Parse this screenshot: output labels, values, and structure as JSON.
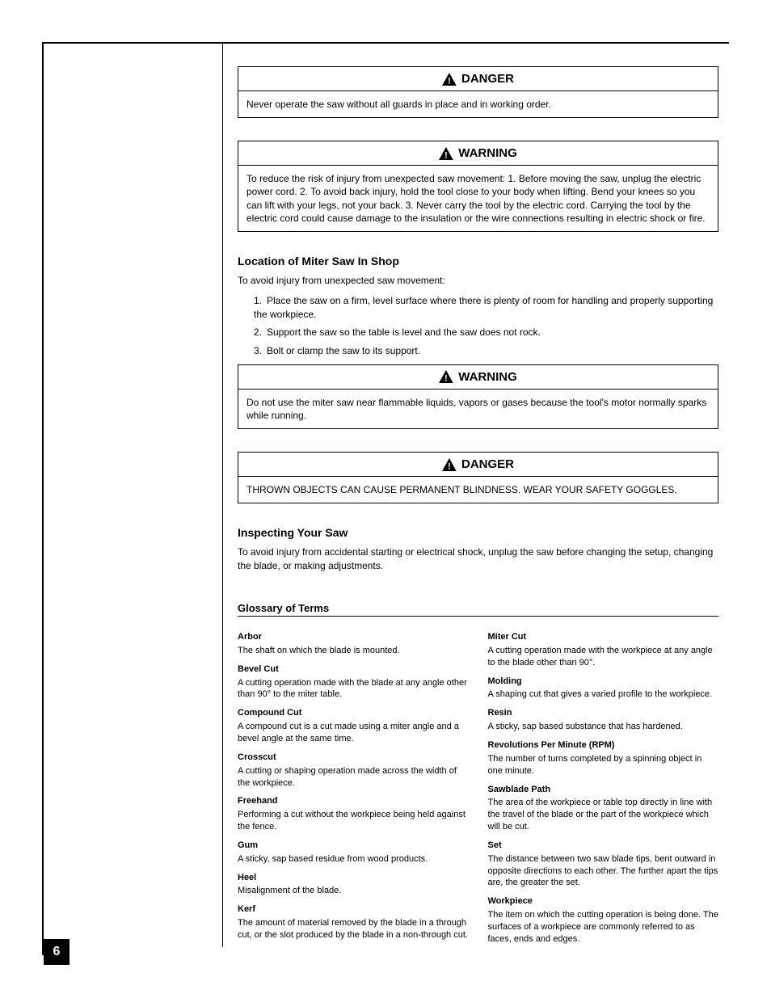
{
  "page_number": "6",
  "callouts": [
    {
      "title": "DANGER",
      "body": "Never operate the saw without all guards in place and in working order."
    },
    {
      "title": "WARNING",
      "body": "To reduce the risk of injury from unexpected saw movement: 1. Before moving the saw, unplug the electric power cord. 2. To avoid back injury, hold the tool close to your body when lifting. Bend your knees so you can lift with your legs, not your back. 3. Never carry the tool by the electric cord. Carrying the tool by the electric cord could cause damage to the insulation or the wire connections resulting in electric shock or fire."
    }
  ],
  "heading_workshop": "Location of Miter Saw In Shop",
  "workshop_intro": "To avoid injury from unexpected saw movement:",
  "workshop_list": [
    "Place the saw on a firm, level surface where there is plenty of room for handling and properly supporting the workpiece.",
    "Support the saw so the table is level and the saw does not rock.",
    "Bolt or clamp the saw to its support."
  ],
  "callouts2": [
    {
      "title": "WARNING",
      "body": "Do not use the miter saw near flammable liquids, vapors or gases because the tool's motor normally sparks while running."
    },
    {
      "title": "DANGER",
      "body": "THROWN OBJECTS CAN CAUSE PERMANENT BLINDNESS. WEAR YOUR SAFETY GOGGLES."
    }
  ],
  "heading_inspectsaw": "Inspecting Your Saw",
  "inspectsaw_body": "To avoid injury from accidental starting or electrical shock, unplug the saw before changing the setup, changing the blade, or making adjustments.",
  "subheading_glossary": "Glossary of Terms",
  "glossary": {
    "left": [
      {
        "term": "Arbor",
        "def": "The shaft on which the blade is mounted."
      },
      {
        "term": "Bevel Cut",
        "def": "A cutting operation made with the blade at any angle other than 90° to the miter table."
      },
      {
        "term": "Compound Cut",
        "def": "A compound cut is a cut made using a miter angle and a bevel angle at the same time."
      },
      {
        "term": "Crosscut",
        "def": "A cutting or shaping operation made across the width of the workpiece."
      },
      {
        "term": "Freehand",
        "def": "Performing a cut without the workpiece being held against the fence."
      },
      {
        "term": "Gum",
        "def": "A sticky, sap based residue from wood products."
      },
      {
        "term": "Heel",
        "def": "Misalignment of the blade."
      },
      {
        "term": "Kerf",
        "def": "The amount of material removed by the blade in a through cut, or the slot produced by the blade in a non-through cut."
      }
    ],
    "right": [
      {
        "term": "Miter Cut",
        "def": "A cutting operation made with the workpiece at any angle to the blade other than 90°."
      },
      {
        "term": "Molding",
        "def": "A shaping cut that gives a varied profile to the workpiece."
      },
      {
        "term": "Resin",
        "def": "A sticky, sap based substance that has hardened."
      },
      {
        "term": "Revolutions Per Minute (RPM)",
        "def": "The number of turns completed by a spinning object in one minute."
      },
      {
        "term": "Sawblade Path",
        "def": "The area of the workpiece or table top directly in line with the travel of the blade or the part of the workpiece which will be cut."
      },
      {
        "term": "Set",
        "def": "The distance between two saw blade tips, bent outward in opposite directions to each other. The further apart the tips are, the greater the set."
      },
      {
        "term": "Workpiece",
        "def": "The item on which the cutting operation is being done. The surfaces of a workpiece are commonly referred to as faces, ends and edges."
      }
    ]
  }
}
